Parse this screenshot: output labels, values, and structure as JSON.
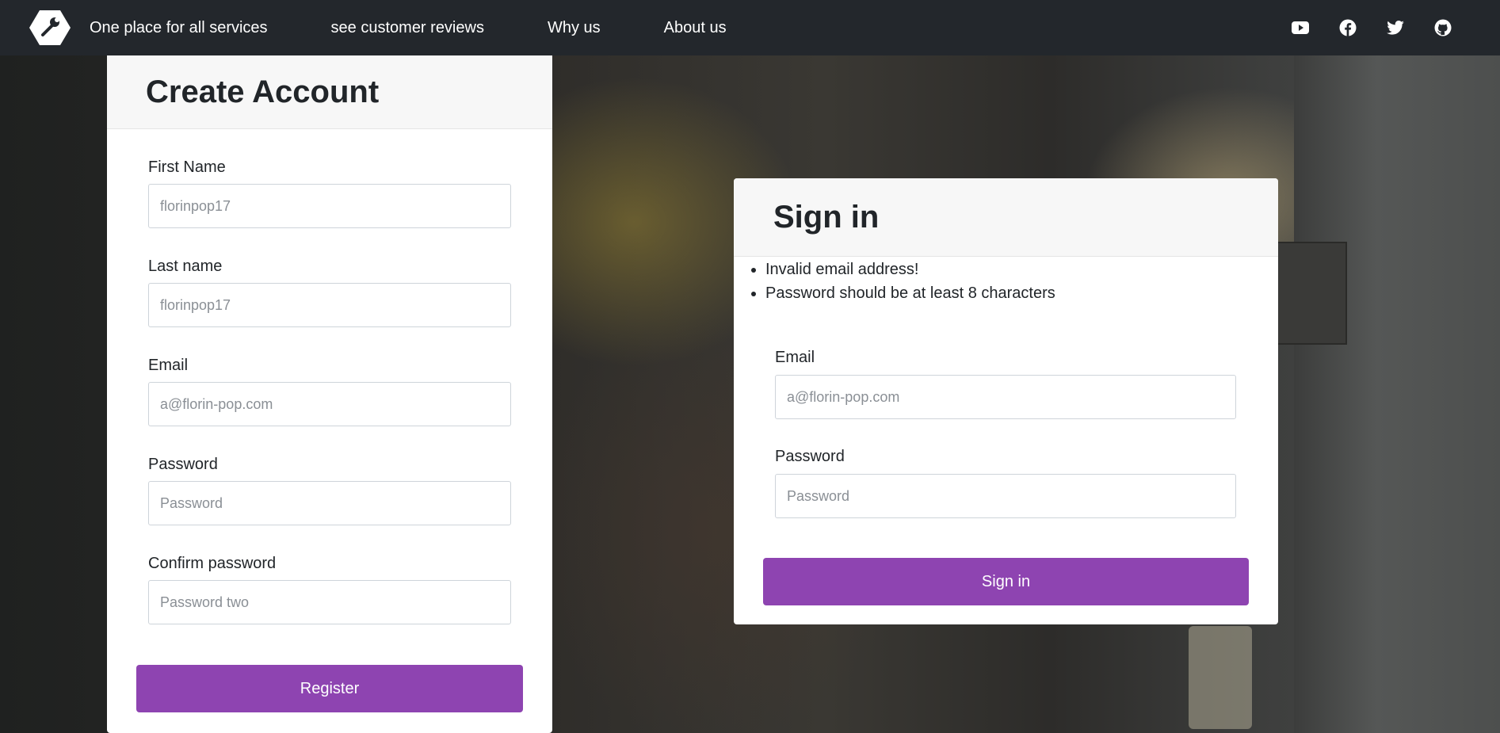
{
  "nav": {
    "links": [
      "One place for all services",
      "see customer reviews",
      "Why us",
      "About us"
    ],
    "social_icons": [
      "youtube-icon",
      "facebook-icon",
      "twitter-icon",
      "github-icon"
    ]
  },
  "create_account": {
    "title": "Create Account",
    "fields": [
      {
        "label": "First Name",
        "placeholder": "florinpop17"
      },
      {
        "label": "Last name",
        "placeholder": "florinpop17"
      },
      {
        "label": "Email",
        "placeholder": "a@florin-pop.com"
      },
      {
        "label": "Password",
        "placeholder": "Password"
      },
      {
        "label": "Confirm password",
        "placeholder": "Password two"
      }
    ],
    "button": "Register"
  },
  "signin": {
    "title": "Sign in",
    "errors": [
      "Invalid email address!",
      "Password should be at least 8 characters"
    ],
    "fields": [
      {
        "label": "Email",
        "placeholder": "a@florin-pop.com"
      },
      {
        "label": "Password",
        "placeholder": "Password"
      }
    ],
    "button": "Sign in"
  },
  "colors": {
    "navbar": "#23272c",
    "accent": "#8e44b1",
    "card_header": "#f7f7f7"
  }
}
